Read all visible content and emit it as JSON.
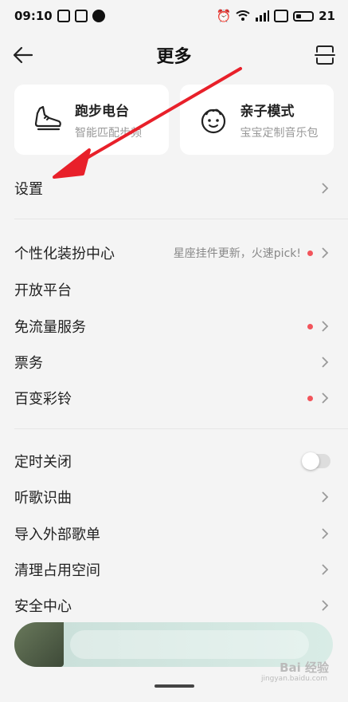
{
  "status": {
    "time": "09:10",
    "battery": "21"
  },
  "header": {
    "title": "更多"
  },
  "cards": [
    {
      "title": "跑步电台",
      "subtitle": "智能匹配步频",
      "icon": "running-shoe-icon"
    },
    {
      "title": "亲子模式",
      "subtitle": "宝宝定制音乐包",
      "icon": "baby-face-icon"
    }
  ],
  "rows": {
    "settings": "设置",
    "skin_center": "个性化装扮中心",
    "skin_hint": "星座挂件更新，火速pick!",
    "open_platform": "开放平台",
    "free_traffic": "免流量服务",
    "tickets": "票务",
    "ringtone": "百变彩铃",
    "sleep_timer": "定时关闭",
    "song_recognize": "听歌识曲",
    "import_playlist": "导入外部歌单",
    "clean_space": "清理占用空间",
    "security": "安全中心"
  },
  "watermark": {
    "text": "Bai 经验",
    "sub": "jingyan.baidu.com"
  },
  "colors": {
    "red_dot": "#f2545b",
    "arrow": "#e8202a",
    "background": "#f4f4f4"
  }
}
